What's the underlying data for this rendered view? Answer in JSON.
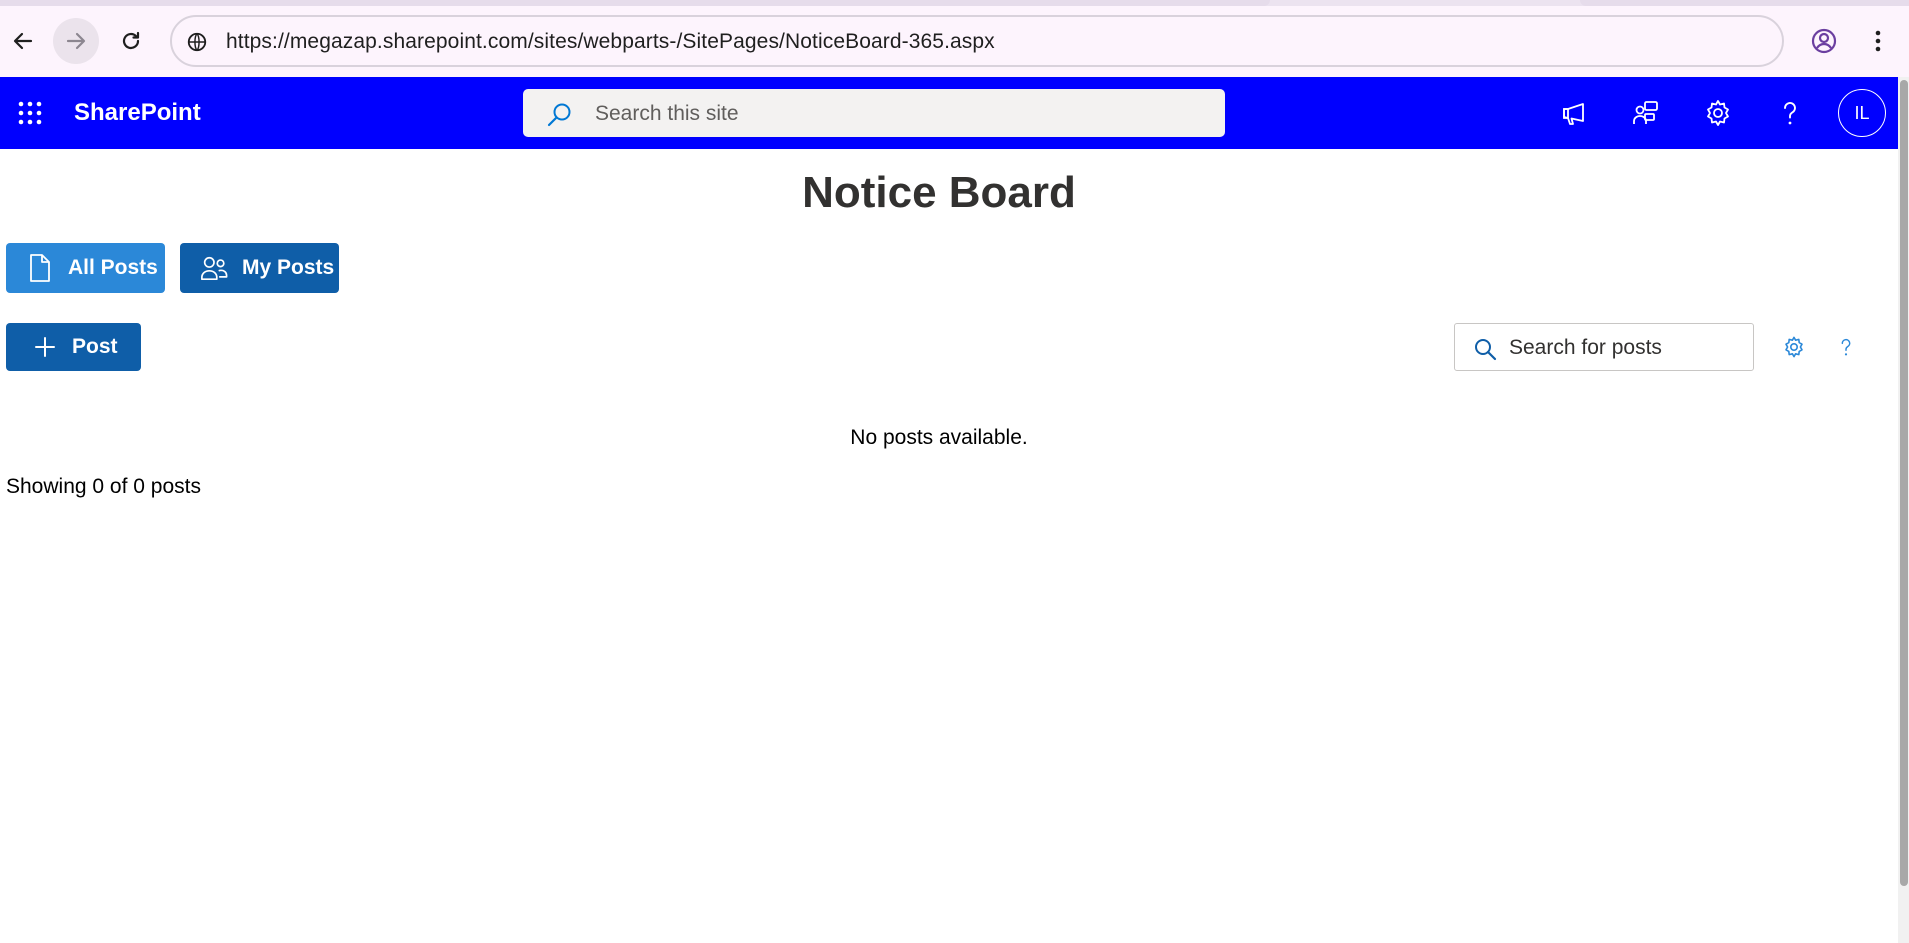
{
  "browser": {
    "url": "https://megazap.sharepoint.com/sites/webparts-/SitePages/NoticeBoard-365.aspx"
  },
  "suite_bar": {
    "brand": "SharePoint",
    "search_placeholder": "Search this site",
    "avatar_initials": "IL",
    "background_color": "#0000ff"
  },
  "page": {
    "title": "Notice Board",
    "filters": {
      "all_posts_label": "All Posts",
      "my_posts_label": "My Posts"
    },
    "post_button_label": "Post",
    "posts_search_placeholder": "Search for posts",
    "empty_message": "No posts available.",
    "count_text": "Showing 0 of 0 posts"
  },
  "icons": {
    "back": "arrow-left-icon",
    "forward": "arrow-right-icon",
    "reload": "reload-icon",
    "site_info": "site-info-icon",
    "profile": "profile-icon",
    "browser_menu": "kebab-menu-icon",
    "app_launcher": "waffle-icon",
    "site_search": "search-icon",
    "announcements": "megaphone-icon",
    "feedback": "feedback-icon",
    "settings": "gear-icon",
    "help": "help-icon",
    "all_posts": "document-icon",
    "my_posts": "people-icon",
    "add": "plus-icon",
    "posts_search": "search-icon",
    "board_settings": "gear-icon",
    "board_help": "help-icon"
  },
  "colors": {
    "primary_button": "#0f5ea8",
    "selected_filter": "#2b88d8"
  }
}
